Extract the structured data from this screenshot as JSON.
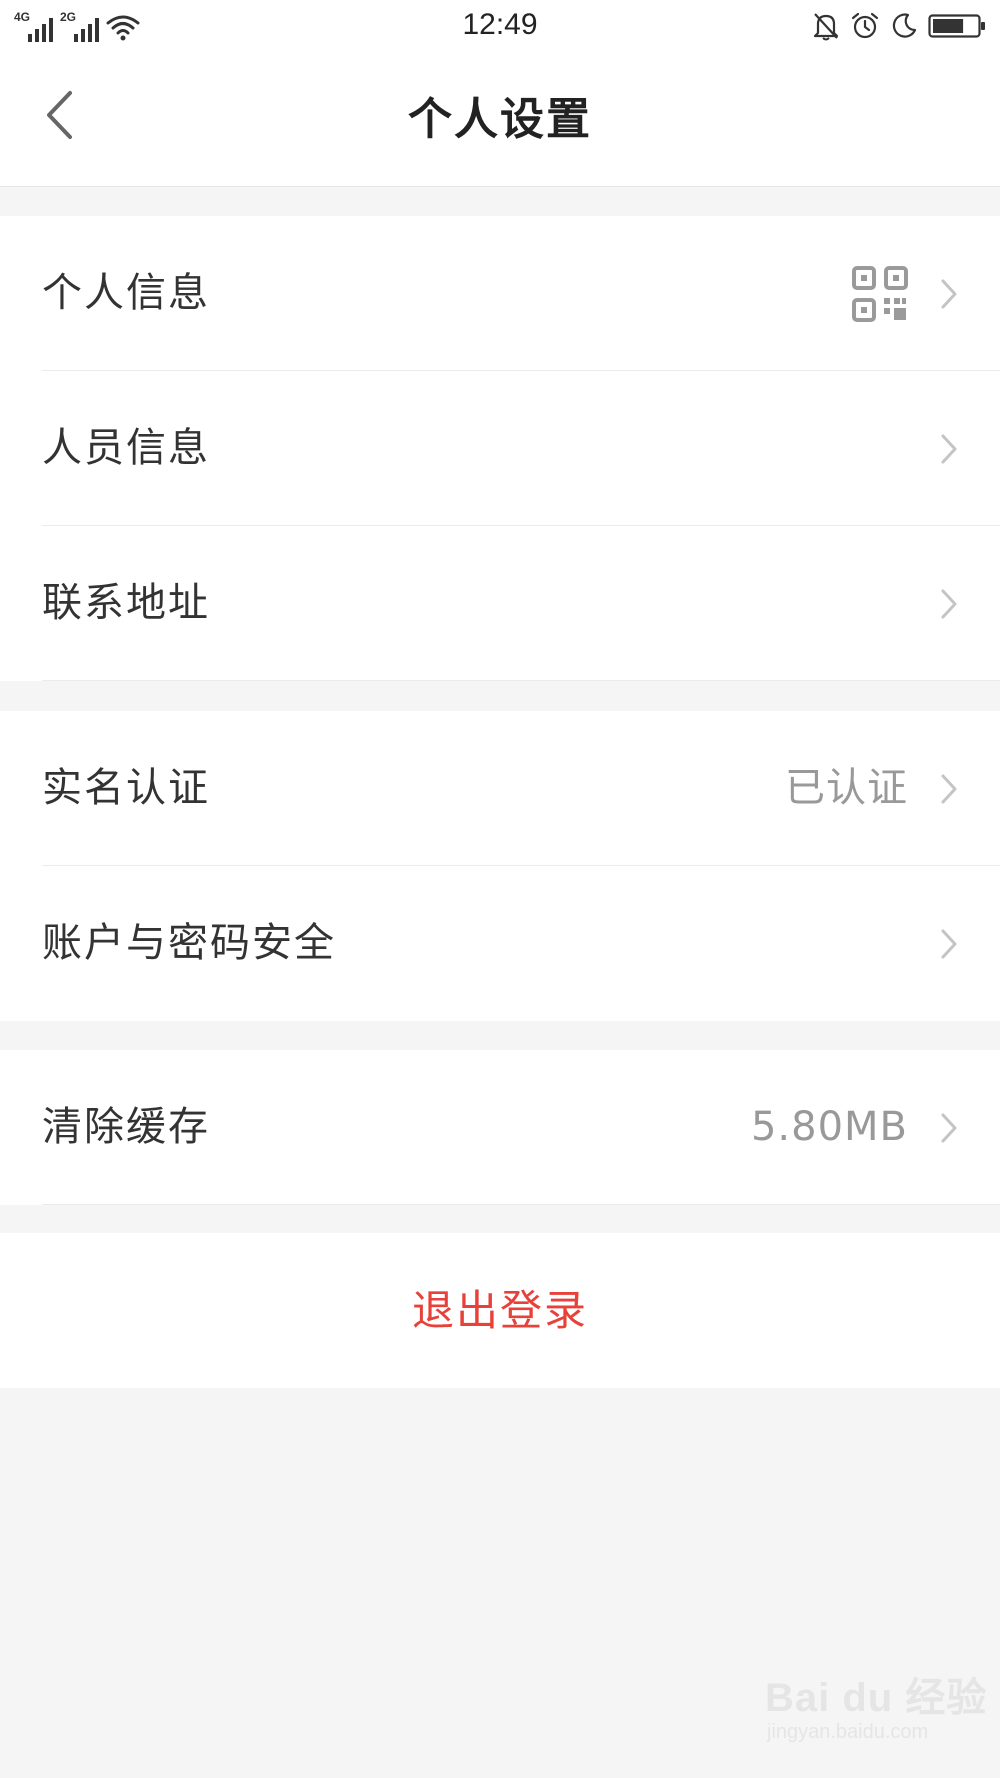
{
  "status_bar": {
    "network_1": "4G",
    "network_2": "2G",
    "time": "12:49",
    "icons": [
      "signal-icon",
      "signal-icon",
      "wifi-icon",
      "bell-off-icon",
      "alarm-icon",
      "moon-icon",
      "battery-icon"
    ],
    "battery_level": 0.7
  },
  "header": {
    "title": "个人设置",
    "back_icon": "chevron-left-icon"
  },
  "groups": [
    {
      "items": [
        {
          "label": "个人信息",
          "icon": "qr-code-icon"
        },
        {
          "label": "人员信息"
        },
        {
          "label": "联系地址"
        }
      ]
    },
    {
      "items": [
        {
          "label": "实名认证",
          "value": "已认证"
        },
        {
          "label": "账户与密码安全"
        }
      ]
    },
    {
      "items": [
        {
          "label": "清除缓存",
          "value": "5.80MB"
        }
      ]
    }
  ],
  "logout": {
    "label": "退出登录"
  },
  "watermark": {
    "brand": "Bai du 经验",
    "url": "jingyan.baidu.com"
  },
  "colors": {
    "background": "#f5f5f5",
    "surface": "#ffffff",
    "text": "#333333",
    "secondary_text": "#999999",
    "danger": "#e8413a",
    "chevron": "#c4c4c4"
  }
}
